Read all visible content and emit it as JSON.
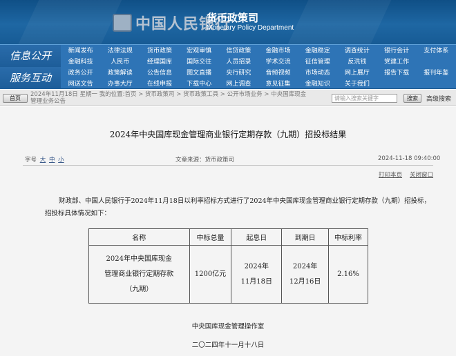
{
  "header": {
    "emblem_text": "中国人民银行",
    "department_cn": "货币政策司",
    "department_en": "Monetary Policy Department"
  },
  "nav": {
    "section1": "信息公开",
    "section2": "服务互动",
    "row1": [
      "新闻发布",
      "法律法规",
      "货币政策",
      "宏观审慎",
      "信贷政策",
      "金融市场",
      "金融稳定",
      "调查统计",
      "银行会计",
      "支付体系"
    ],
    "row2": [
      "金融科技",
      "人民币",
      "经理国库",
      "国际交往",
      "人员招录",
      "学术交流",
      "征信管理",
      "反洗钱",
      "党建工作",
      ""
    ],
    "row3": [
      "政务公开",
      "政策解读",
      "公告信息",
      "图文直播",
      "央行研究",
      "音频视频",
      "市场动态",
      "网上展厅",
      "报告下载",
      "报刊年鉴"
    ],
    "row4": [
      "网送文告",
      "办事大厅",
      "在线申报",
      "下载中心",
      "网上调查",
      "意见征集",
      "金融知识",
      "关于我们",
      "",
      ""
    ]
  },
  "toolbar": {
    "home_label": "首页",
    "breadcrumb_line1": "2024年11月18日 星期一   我的位置:首页 > 货币政策司 > 货币政策工具 > 公开市场业务 > 中央国库现金",
    "breadcrumb_line2": "管理业务公告",
    "search_placeholder": "请输入搜索关键字",
    "search_label": "搜索",
    "advanced_search": "高级搜索"
  },
  "article": {
    "title": "2024年中央国库现金管理商业银行定期存款（九期）招投标结果",
    "font_size_label": "字号",
    "font_sizes": [
      "大",
      "中",
      "小"
    ],
    "source": "文章来源：货币政策司",
    "date": "2024-11-18 09:40:00",
    "print_label": "打印本页",
    "close_label": "关闭窗口",
    "paragraph": "财政部、中国人民银行于2024年11月18日以利率招标方式进行了2024年中央国库现金管理商业银行定期存款（九期）招投标，招投标具体情况如下：",
    "table": {
      "headers": [
        "名称",
        "中标总量",
        "起息日",
        "到期日",
        "中标利率"
      ],
      "row": {
        "name_line1": "2024年中央国库现金",
        "name_line2": "管理商业银行定期存款",
        "name_line3": "（九期）",
        "amount": "1200亿元",
        "start_line1": "2024年",
        "start_line2": "11月18日",
        "end_line1": "2024年",
        "end_line2": "12月16日",
        "rate": "2.16%"
      }
    },
    "signature": "中央国库现金管理操作室",
    "signature_date": "二〇二四年十一月十八日"
  }
}
